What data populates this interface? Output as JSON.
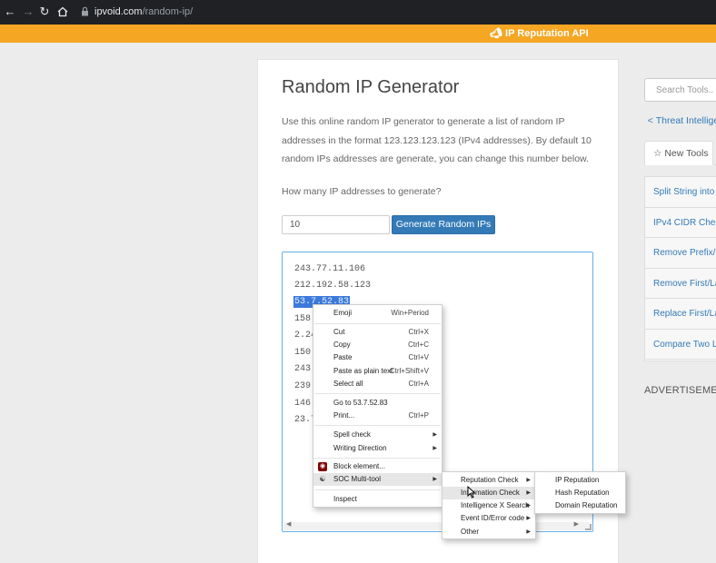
{
  "browser": {
    "url_domain": "ipvoid.com",
    "url_path": "/random-ip/",
    "back_icon": "arrow-left-icon",
    "forward_icon": "arrow-right-icon",
    "reload_icon": "reload-icon",
    "home_icon": "home-icon"
  },
  "banner": {
    "link_text": "IP Reputation API",
    "color": "#f5a623"
  },
  "main": {
    "title": "Random IP Generator",
    "intro": "Use this online random IP generator to generate a list of random IP addresses in the format 123.123.123.123 (IPv4 addresses). By default 10 random IPs addresses are generate, you can change this number below.",
    "prompt": "How many IP addresses to generate?",
    "count_value": "10",
    "generate_label": "Generate Random IPs",
    "ips": [
      "243.77.11.106",
      "212.192.58.123",
      "53.7.52.83",
      "158.",
      "2.24",
      "150.",
      "243.",
      "239.",
      "146.",
      "23.7"
    ],
    "selected_index": 2
  },
  "sidebar": {
    "search_placeholder": "Search Tools..",
    "threat_link": "Threat Intelligen",
    "tab_new": "New Tools",
    "tools": [
      "Split String into S",
      "IPv4 CIDR Check",
      "Remove Prefix/S",
      "Remove First/La",
      "Replace First/Las",
      "Compare Two Li"
    ],
    "ads": "ADVERTISEMEN"
  },
  "context_menu": {
    "items": [
      {
        "label": "Emoji",
        "shortcut": "Win+Period"
      },
      {
        "label": "Cut",
        "shortcut": "Ctrl+X"
      },
      {
        "label": "Copy",
        "shortcut": "Ctrl+C"
      },
      {
        "label": "Paste",
        "shortcut": "Ctrl+V"
      },
      {
        "label": "Paste as plain text",
        "shortcut": "Ctrl+Shift+V"
      },
      {
        "label": "Select all",
        "shortcut": "Ctrl+A"
      },
      {
        "label": "Go to 53.7.52.83",
        "shortcut": ""
      },
      {
        "label": "Print...",
        "shortcut": "Ctrl+P"
      },
      {
        "label": "Spell check",
        "shortcut": ""
      },
      {
        "label": "Writing Direction",
        "shortcut": ""
      },
      {
        "label": "Block element...",
        "shortcut": ""
      },
      {
        "label": "SOC Multi-tool",
        "shortcut": ""
      },
      {
        "label": "Inspect",
        "shortcut": ""
      }
    ]
  },
  "soc_menu": {
    "items": [
      "Reputation Check",
      "Information Check",
      "Intelligence X Search",
      "Event ID/Error code",
      "Other"
    ]
  },
  "reputation_menu": {
    "items": [
      "IP Reputation",
      "Hash Reputation",
      "Domain Reputation"
    ]
  }
}
